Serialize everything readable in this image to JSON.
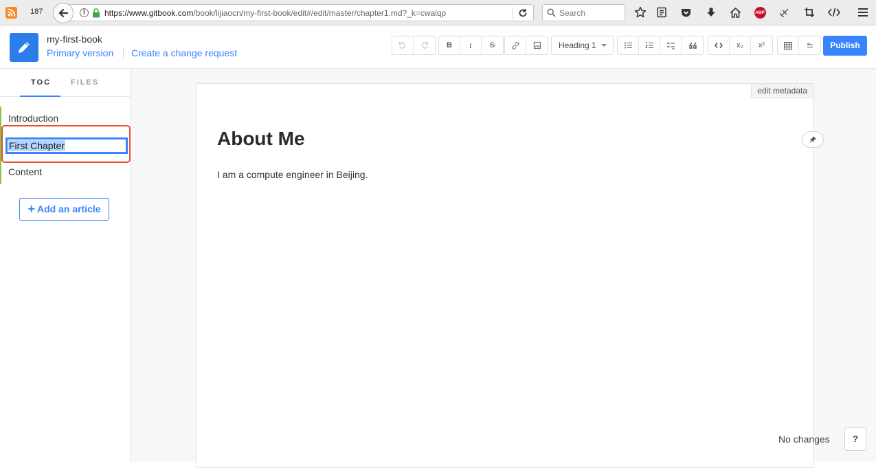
{
  "browser": {
    "tab_count": "187",
    "url_host": "https://www.gitbook.com",
    "url_path": "/book/lijiaocn/my-first-book/edit#/edit/master/chapter1.md?_k=cwalqp",
    "search_placeholder": "Search",
    "abp_label": "ABP"
  },
  "header": {
    "book_title": "my-first-book",
    "primary_version": "Primary version",
    "change_request": "Create a change request",
    "heading_select": "Heading 1",
    "publish": "Publish",
    "btn_bold": "B",
    "btn_italic": "i",
    "btn_strike": "S",
    "btn_subscript": "x₂",
    "btn_superscript": "x²"
  },
  "sidebar": {
    "tab_toc": "TOC",
    "tab_files": "FILES",
    "items": [
      {
        "label": "Introduction"
      },
      {
        "label": "First Chapter"
      },
      {
        "label": "Content"
      }
    ],
    "add_article": "Add an article"
  },
  "editor": {
    "edit_metadata": "edit metadata",
    "title": "About Me",
    "body": "I am a compute engineer in Beijing.",
    "status": "No changes",
    "help": "?"
  },
  "colors": {
    "accent": "#3884ff",
    "toc_line": "#8bc34a",
    "highlight": "#e8502f"
  }
}
